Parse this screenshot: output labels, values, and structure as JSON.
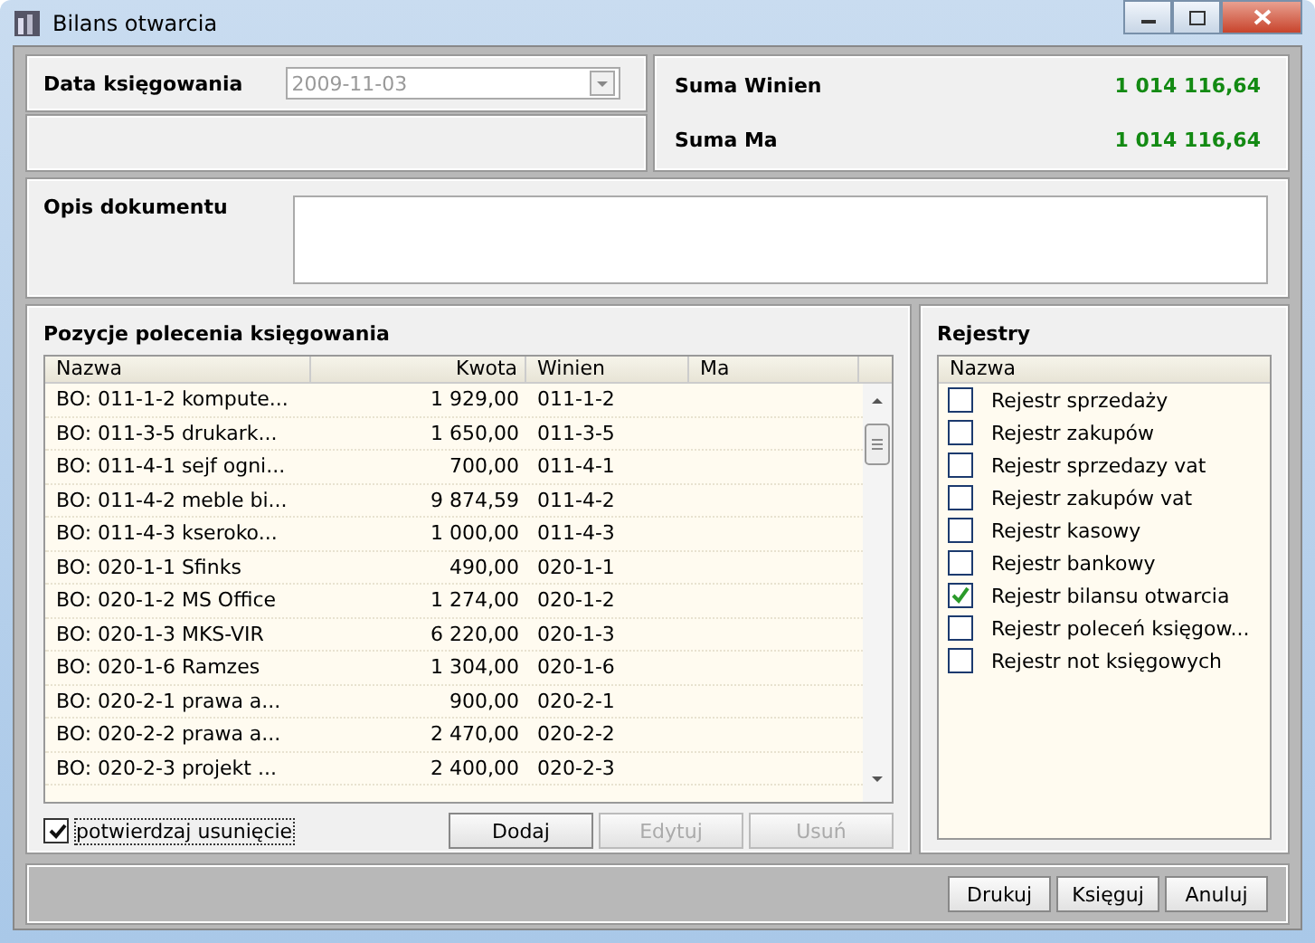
{
  "window": {
    "title": "Bilans otwarcia"
  },
  "posting_date": {
    "label": "Data księgowania",
    "value": "2009-11-03",
    "disabled": true
  },
  "totals": [
    {
      "label": "Suma Winien",
      "value": "1 014 116,64"
    },
    {
      "label": "Suma Ma",
      "value": "1 014 116,64"
    }
  ],
  "description": {
    "label": "Opis dokumentu"
  },
  "positions": {
    "title": "Pozycje polecenia księgowania",
    "columns": [
      "Nazwa",
      "Kwota",
      "Winien",
      "Ma"
    ],
    "rows": [
      [
        "BO: 011-1-2 kompute...",
        "1 929,00",
        "011-1-2"
      ],
      [
        "BO: 011-3-5 drukark...",
        "1 650,00",
        "011-3-5"
      ],
      [
        "BO: 011-4-1 sejf ogni...",
        "700,00",
        "011-4-1"
      ],
      [
        "BO: 011-4-2 meble bi...",
        "9 874,59",
        "011-4-2"
      ],
      [
        "BO: 011-4-3 kseroko...",
        "1 000,00",
        "011-4-3"
      ],
      [
        "BO: 020-1-1 Sfinks",
        "490,00",
        "020-1-1"
      ],
      [
        "BO: 020-1-2 MS Office",
        "1 274,00",
        "020-1-2"
      ],
      [
        "BO: 020-1-3 MKS-VIR",
        "6 220,00",
        "020-1-3"
      ],
      [
        "BO: 020-1-6 Ramzes",
        "1 304,00",
        "020-1-6"
      ],
      [
        "BO: 020-2-1 prawa a...",
        "900,00",
        "020-2-1"
      ],
      [
        "BO: 020-2-2 prawa a...",
        "2 470,00",
        "020-2-2"
      ],
      [
        "BO: 020-2-3 projekt ...",
        "2 400,00",
        "020-2-3"
      ]
    ],
    "confirm_delete": {
      "label": "potwierdzaj usunięcie",
      "checked": true
    },
    "buttons": [
      {
        "label": "Dodaj",
        "disabled": false
      },
      {
        "label": "Edytuj",
        "disabled": true
      },
      {
        "label": "Usuń",
        "disabled": true
      }
    ]
  },
  "registers": {
    "title": "Rejestry",
    "column": "Nazwa",
    "items": [
      {
        "label": "Rejestr sprzedaży",
        "checked": false
      },
      {
        "label": "Rejestr zakupów",
        "checked": false
      },
      {
        "label": "Rejestr sprzedazy vat",
        "checked": false
      },
      {
        "label": "Rejestr zakupów vat",
        "checked": false
      },
      {
        "label": "Rejestr kasowy",
        "checked": false
      },
      {
        "label": "Rejestr bankowy",
        "checked": false
      },
      {
        "label": "Rejestr bilansu otwarcia",
        "checked": true
      },
      {
        "label": "Rejestr poleceń księgow...",
        "checked": false
      },
      {
        "label": "Rejestr not księgowych",
        "checked": false
      }
    ]
  },
  "footer_buttons": [
    "Drukuj",
    "Księguj",
    "Anuluj"
  ]
}
